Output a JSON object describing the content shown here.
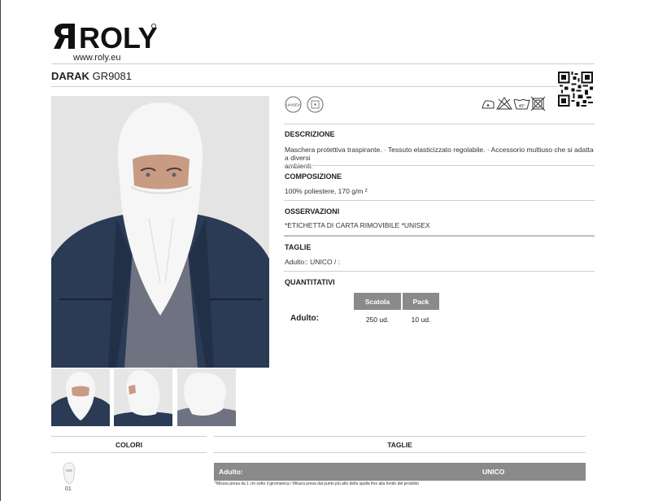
{
  "brand": {
    "logo_text": "ROLY",
    "website": "www.roly.eu"
  },
  "product": {
    "name": "DARAK",
    "code": "GR9081"
  },
  "icons": {
    "unisex": "unisex-icon",
    "unisex_text": "UNISEX",
    "fabric": "fabric-tag-icon",
    "qr": "qr-code-icon",
    "care": [
      "iron-icon",
      "no-bleach-icon",
      "wash-40-icon",
      "no-tumble-dry-icon"
    ],
    "wash_temp": "40°"
  },
  "sections": {
    "descrizione": {
      "label": "DESCRIZIONE",
      "line1": "Maschera protettiva traspirante. · Tessuto elasticizzato regolabile. · Accessorio multiuso che si adatta a diversi",
      "line2": "ambienti."
    },
    "composizione": {
      "label": "COMPOSIZIONE",
      "text": "100% poliestere, 170 g/m ²"
    },
    "osservazioni": {
      "label": "OSSERVAZIONI",
      "text": "*ETICHETTA DI CARTA RIMOVIBILE *UNISEX"
    },
    "taglie": {
      "label": "TAGLIE",
      "text": "Adulto:: UNICO / :"
    },
    "quantitativi": {
      "label": "QUANTITATIVI",
      "headers": [
        "Scatola",
        "Pack"
      ],
      "row_label": "Adulto:",
      "values": [
        "250 ud.",
        "10 ud."
      ]
    }
  },
  "bottom": {
    "colori_title": "COLORI",
    "taglie_title": "TAGLIE",
    "size_row_label": "Adulto:",
    "size_row_value": "UNICO",
    "footnote": "*Misura presa da 1 cm sotto il giromanica / Misura presa dal punto più alto della spalla fino alla fondo del prodotto",
    "color_code": "01",
    "color_hex": "#f4f4f4"
  },
  "colors": {
    "navy_jacket": "#2b3a55",
    "grey_bg": "#e8e8e8",
    "table_header": "#8a8a8a"
  }
}
